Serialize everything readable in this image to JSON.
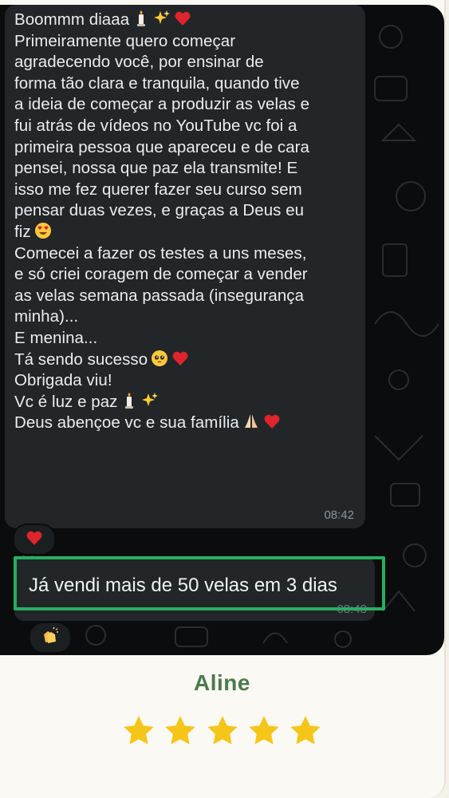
{
  "message_1": {
    "lines": [
      "Boommm diaaa",
      "Primeiramente quero começar",
      "agradecendo você, por ensinar de",
      "forma tão clara e tranquila, quando tive",
      "a ideia de começar a produzir as velas e",
      "fui atrás de vídeos no YouTube vc foi a",
      "primeira pessoa que apareceu e de cara",
      "pensei, nossa que paz ela transmite! E",
      "isso me fez querer fazer seu curso sem",
      "pensar duas vezes, e graças a Deus eu",
      "fiz",
      "Comecei a fazer os testes a uns meses,",
      "e só criei coragem de começar a vender",
      "as velas semana passada (insegurança",
      "minha)...",
      "E menina...",
      "Tá sendo sucesso",
      "Obrigada viu!",
      "Vc é luz e paz",
      "Deus abençoe vc e sua família"
    ],
    "time": "08:42",
    "reaction": "red-heart"
  },
  "message_2": {
    "text": "Já vendi mais de 50 velas em 3 dias",
    "time": "08:48",
    "reaction": "clapping-hands"
  },
  "testimonial": {
    "name": "Aline",
    "rating": 5,
    "rating_max": 5
  },
  "colors": {
    "chat_background": "#0b0c0d",
    "bubble": "#232629",
    "highlight": "#27ae60",
    "name": "#4c7a4d",
    "star": "#f5c518",
    "heart": "#e0242c"
  }
}
